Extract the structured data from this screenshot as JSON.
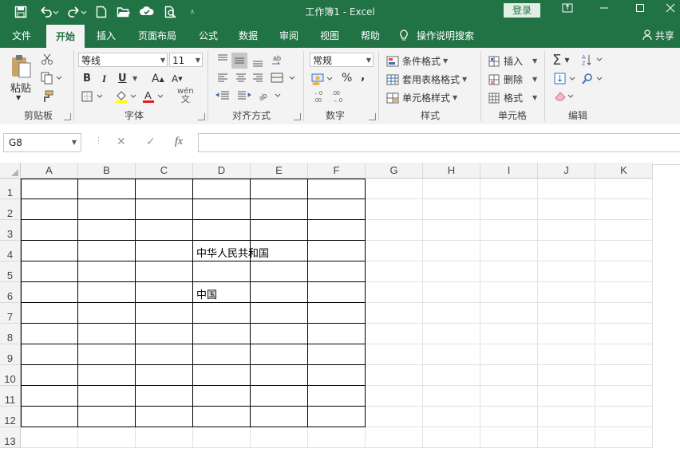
{
  "titlebar": {
    "title": "工作簿1  -  Excel",
    "login_label": "登录",
    "qat_icons": [
      "save-icon",
      "undo-icon",
      "redo-icon",
      "new-file-icon",
      "open-icon",
      "cloud-sync-icon",
      "print-preview-icon",
      "customize-qat-icon"
    ]
  },
  "tabs": {
    "file": "文件",
    "home": "开始",
    "insert": "插入",
    "layout": "页面布局",
    "formula": "公式",
    "data": "数据",
    "review": "审阅",
    "view": "视图",
    "help": "帮助",
    "tellme": "操作说明搜索",
    "share": "共享"
  },
  "ribbon": {
    "clipboard": {
      "paste": "粘贴",
      "label": "剪贴板"
    },
    "font": {
      "name": "等线",
      "size": "11",
      "bold": "B",
      "italic": "I",
      "underline": "U",
      "label": "字体",
      "phonetic": "wén"
    },
    "align": {
      "label": "对齐方式"
    },
    "number": {
      "format": "常规",
      "label": "数字"
    },
    "styles": {
      "cond": "条件格式",
      "table": "套用表格格式",
      "cell": "单元格样式",
      "label": "样式"
    },
    "cells": {
      "insert": "插入",
      "delete": "删除",
      "format": "格式",
      "label": "单元格"
    },
    "editing": {
      "label": "编辑"
    }
  },
  "formula_bar": {
    "name_box": "G8",
    "content": ""
  },
  "sheet": {
    "columns": [
      "A",
      "B",
      "C",
      "D",
      "E",
      "F",
      "G",
      "H",
      "I",
      "J",
      "K"
    ],
    "rows": [
      "1",
      "2",
      "3",
      "4",
      "5",
      "6",
      "7",
      "8",
      "9",
      "10",
      "11",
      "12",
      "13"
    ],
    "cells": {
      "D4": "中华人民共和国",
      "D6": "中国"
    }
  },
  "colors": {
    "brand": "#217346",
    "ribbon_bg": "#f3f3f3",
    "header_bg": "#f3f3f3"
  }
}
